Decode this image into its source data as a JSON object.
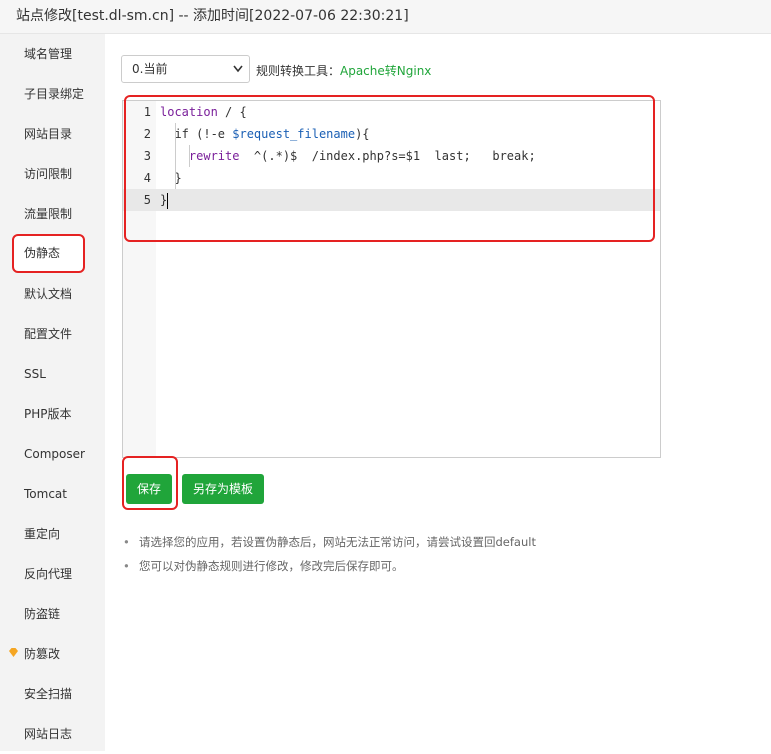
{
  "window": {
    "title": "站点修改[test.dl-sm.cn] -- 添加时间[2022-07-06 22:30:21]"
  },
  "sidebar": {
    "items": [
      {
        "label": "域名管理"
      },
      {
        "label": "子目录绑定"
      },
      {
        "label": "网站目录"
      },
      {
        "label": "访问限制"
      },
      {
        "label": "流量限制"
      },
      {
        "label": "伪静态",
        "active": true
      },
      {
        "label": "默认文档"
      },
      {
        "label": "配置文件"
      },
      {
        "label": "SSL"
      },
      {
        "label": "PHP版本"
      },
      {
        "label": "Composer"
      },
      {
        "label": "Tomcat"
      },
      {
        "label": "重定向"
      },
      {
        "label": "反向代理"
      },
      {
        "label": "防盗链"
      },
      {
        "label": "防篡改",
        "icon": "gem-icon"
      },
      {
        "label": "安全扫描"
      },
      {
        "label": "网站日志"
      }
    ]
  },
  "toolbar": {
    "select_value": "0.当前",
    "tool_label": "规则转换工具：",
    "tool_link": "Apache转Nginx"
  },
  "editor": {
    "lines": [
      {
        "num": "1",
        "parts": [
          {
            "t": "location",
            "c": "kw-loc"
          },
          {
            "t": " / {",
            "c": ""
          }
        ]
      },
      {
        "num": "2",
        "parts": [
          {
            "t": "  if (!-e ",
            "c": ""
          },
          {
            "t": "$request_filename",
            "c": "var"
          },
          {
            "t": "){",
            "c": ""
          }
        ]
      },
      {
        "num": "3",
        "parts": [
          {
            "t": "    ",
            "c": ""
          },
          {
            "t": "rewrite",
            "c": "kw-rw"
          },
          {
            "t": "  ^(.*)$  /index.php?s=$1  last;   break;",
            "c": ""
          }
        ]
      },
      {
        "num": "4",
        "parts": [
          {
            "t": "  }",
            "c": ""
          }
        ]
      },
      {
        "num": "5",
        "parts": [
          {
            "t": "}",
            "c": ""
          }
        ]
      }
    ]
  },
  "actions": {
    "save_label": "保存",
    "save_template_label": "另存为模板"
  },
  "notes": [
    "请选择您的应用，若设置伪静态后，网站无法正常访问，请尝试设置回default",
    "您可以对伪静态规则进行修改，修改完后保存即可。"
  ],
  "colors": {
    "accent": "#20a53a",
    "highlight": "#e52222"
  }
}
